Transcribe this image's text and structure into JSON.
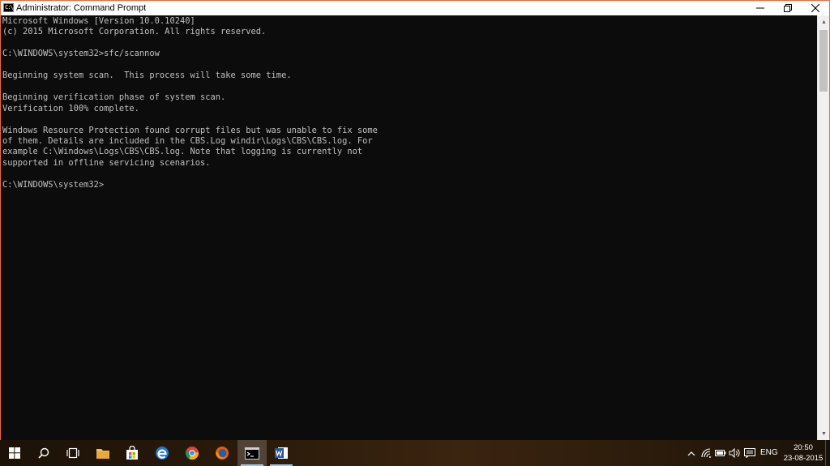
{
  "window": {
    "title": "Administrator: Command Prompt",
    "icon_text": "C:\\",
    "controls": {
      "minimize": "minimize-icon",
      "restore": "restore-icon",
      "close": "close-icon"
    }
  },
  "console": {
    "text": "Microsoft Windows [Version 10.0.10240]\n(c) 2015 Microsoft Corporation. All rights reserved.\n\nC:\\WINDOWS\\system32>sfc/scannow\n\nBeginning system scan.  This process will take some time.\n\nBeginning verification phase of system scan.\nVerification 100% complete.\n\nWindows Resource Protection found corrupt files but was unable to fix some\nof them. Details are included in the CBS.Log windir\\Logs\\CBS\\CBS.log. For\nexample C:\\Windows\\Logs\\CBS\\CBS.log. Note that logging is currently not\nsupported in offline servicing scenarios.\n\nC:\\WINDOWS\\system32>"
  },
  "taskbar": {
    "items": [
      "windows-start",
      "search",
      "task-view",
      "file-explorer",
      "store",
      "edge",
      "chrome",
      "firefox",
      "command-prompt",
      "word"
    ],
    "tray": {
      "language": "ENG",
      "time": "20:50",
      "date": "23-08-2015"
    }
  },
  "colors": {
    "window_border": "#e46a3d",
    "console_text": "#c0c0c0",
    "console_bg": "#0c0c0c"
  }
}
